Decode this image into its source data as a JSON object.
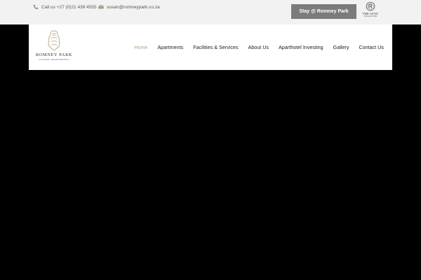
{
  "topbar": {
    "phone": "Call us +27 (0)21 439 4555",
    "email": "susan@romneypark.co.za",
    "stay_button": "Stay @ Romney Park",
    "partner_logo": {
      "line1": "THE STAY",
      "line2": "COLLECTION"
    }
  },
  "brand": {
    "name": "ROMNEY PARK",
    "tagline": "LUXURY APARTMENTS"
  },
  "nav": {
    "items": [
      {
        "label": "Home",
        "active": true
      },
      {
        "label": "Apartments"
      },
      {
        "label": "Facilities & Services"
      },
      {
        "label": "About Us"
      },
      {
        "label": "Aparthotel Investing"
      },
      {
        "label": "Gallery"
      },
      {
        "label": "Contact Us"
      }
    ]
  },
  "colors": {
    "accent": "#b9a27a",
    "topbar_bg": "#f2f2f2",
    "button_bg": "#7b7b7b",
    "hero_bg": "#000000"
  },
  "icons": {
    "phone": "phone-icon",
    "email": "envelope-icon"
  }
}
